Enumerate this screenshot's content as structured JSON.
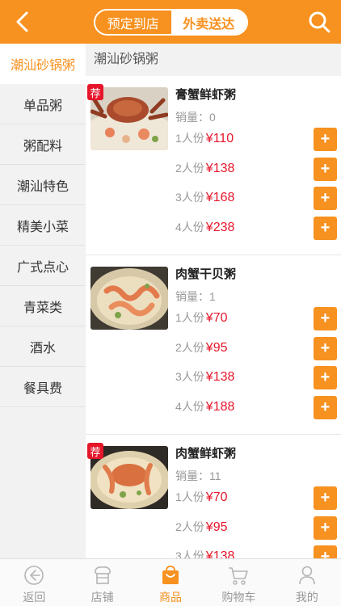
{
  "header": {
    "back_icon": "chevron-left-icon",
    "search_icon": "search-icon",
    "modes": [
      "预定到店",
      "外卖送达"
    ],
    "active_mode": "外卖送达"
  },
  "sidebar": {
    "items": [
      "潮汕砂锅粥",
      "单品粥",
      "粥配料",
      "潮汕特色",
      "精美小菜",
      "广式点心",
      "青菜类",
      "酒水",
      "餐具费"
    ],
    "active": "潮汕砂锅粥"
  },
  "section_title": "潮汕砂锅粥",
  "dishes": [
    {
      "name": "膏蟹鲜虾粥",
      "recommended": true,
      "badge": "荐",
      "sales": "销量：0",
      "options": [
        {
          "portion": "1人份",
          "price": "¥110"
        },
        {
          "portion": "2人份",
          "price": "¥138"
        },
        {
          "portion": "3人份",
          "price": "¥168"
        },
        {
          "portion": "4人份",
          "price": "¥238"
        }
      ]
    },
    {
      "name": "肉蟹干贝粥",
      "recommended": false,
      "sales": "销量：1",
      "options": [
        {
          "portion": "1人份",
          "price": "¥70"
        },
        {
          "portion": "2人份",
          "price": "¥95"
        },
        {
          "portion": "3人份",
          "price": "¥138"
        },
        {
          "portion": "4人份",
          "price": "¥188"
        }
      ]
    },
    {
      "name": "肉蟹鲜虾粥",
      "recommended": true,
      "badge": "荐",
      "sales": "销量：11",
      "options": [
        {
          "portion": "1人份",
          "price": "¥70"
        },
        {
          "portion": "2人份",
          "price": "¥95"
        },
        {
          "portion": "3人份",
          "price": "¥138"
        }
      ]
    }
  ],
  "add_label": "+",
  "tabbar": {
    "items": [
      {
        "label": "返回",
        "icon": "back-circle-icon"
      },
      {
        "label": "店铺",
        "icon": "store-icon"
      },
      {
        "label": "商品",
        "icon": "shopping-bag-icon"
      },
      {
        "label": "购物车",
        "icon": "cart-icon"
      },
      {
        "label": "我的",
        "icon": "user-icon"
      }
    ],
    "active": "商品"
  },
  "colors": {
    "accent": "#f7911f",
    "price": "#e6162a",
    "badge": "#e6162a"
  }
}
